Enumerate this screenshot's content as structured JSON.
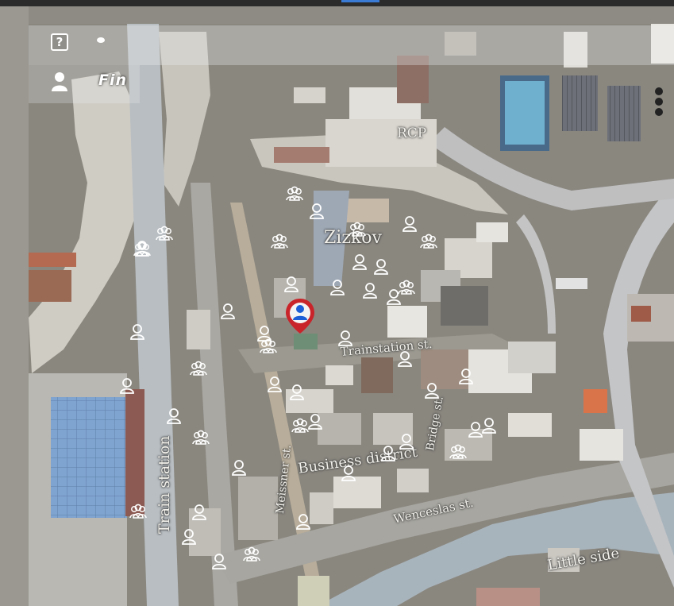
{
  "hud": {
    "help_label": "?",
    "player_name": "Fin"
  },
  "map": {
    "labels": {
      "rcp": "RCP",
      "zizkov": "Zizkov",
      "trainstation_st": "Trainstation st.",
      "train_station": "Train station",
      "meissner_st": "Meissner st.",
      "bridge_st": "Bridge st.",
      "business_district": "Business district",
      "wenceslas_st": "Wenceslas st.",
      "little_side": "Little side"
    },
    "icons": {
      "single_person": "person-icon",
      "group": "group-icon",
      "player": "player-location-icon"
    }
  },
  "colors": {
    "accent": "#3a7bd5",
    "player_marker": "#c8242a",
    "river": "#a9b5bd",
    "ground": "#8f8d85"
  }
}
